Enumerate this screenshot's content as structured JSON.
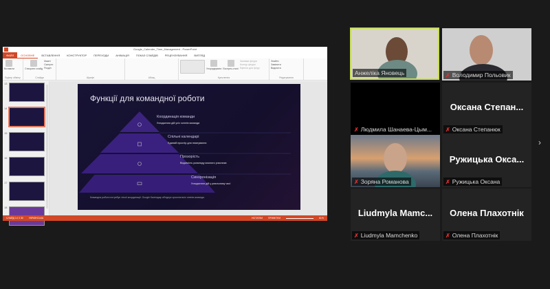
{
  "powerpoint": {
    "window_title": "Google_Calender_Time_Management - PowerPoint",
    "tabs": [
      "ФАЙЛ",
      "ОСНОВНЕ",
      "ВСТАВЛЕННЯ",
      "КОНСТРУКТОР",
      "ПЕРЕХОДИ",
      "АНІМАЦІЯ",
      "ПОКАЗ СЛАЙДІВ",
      "РЕЦЕНЗУВАННЯ",
      "ВИГЛЯД"
    ],
    "ribbon_groups": [
      "Буфер обміну",
      "Слайди",
      "Шрифт",
      "Абзац",
      "Креслення",
      "Редагування"
    ],
    "ribbon_buttons": {
      "paste": "Вставити",
      "new_slide": "Створити слайд",
      "layout": "Макет",
      "reset": "Скинути",
      "section": "Розділ",
      "arrange": "Упорядкувати",
      "quick_styles": "Експрес-стилі",
      "fill": "Заливка фігури",
      "outline": "Контур фігури",
      "effects": "Ефекти для фігур",
      "find": "Знайти",
      "replace": "Замінити",
      "select": "Виділити"
    },
    "thumbnails": [
      "13",
      "14",
      "15",
      "16",
      "17",
      "18"
    ],
    "selected_slide": "14",
    "slide": {
      "title": "Функції для командної роботи",
      "levels": [
        {
          "title": "Координація команди",
          "desc": "Узгодження дій усіх членів команди"
        },
        {
          "title": "Спільні календарі",
          "desc": "Єдиний простір для планування"
        },
        {
          "title": "Прозорість",
          "desc": "Видимість розкладу кожного учасника"
        },
        {
          "title": "Синхронізація",
          "desc": "Узгодження дій у реальному часі"
        }
      ],
      "footer": "Командна робота потребує чіткої координації. Google Календар об'єднує зусилля всіх членів команди."
    },
    "status": {
      "slide": "СЛАЙД 14 З 30",
      "language": "УКРАЇНСЬКА",
      "notes": "НОТАТКИ",
      "comments": "ПРИМІТКИ",
      "zoom": "61%"
    }
  },
  "participants": [
    {
      "name": "Анжеліка Яновець",
      "muted": false,
      "video": true,
      "active": true
    },
    {
      "name": "Володимир Польовик",
      "muted": true,
      "video": true
    },
    {
      "name": "Людмила Шанаева-Цым...",
      "muted": true,
      "video": false
    },
    {
      "name": "Оксана Степанюк",
      "big": "Оксана  Степан...",
      "muted": true,
      "video": false
    },
    {
      "name": "Зоряна Романова",
      "muted": true,
      "video": true
    },
    {
      "name": "Ружицька Оксана",
      "big": "Ружицька  Окса...",
      "muted": true,
      "video": false
    },
    {
      "name": "Liudmyla Mamchenko",
      "big": "Liudmyla  Mamc...",
      "muted": true,
      "video": false
    },
    {
      "name": "Олена Плахотнік",
      "big": "Олена Плахотнік",
      "muted": true,
      "video": false
    }
  ],
  "colors": {
    "accent": "#d24726",
    "active_speaker": "#c7dd5a",
    "muted": "#e0302f",
    "slide_bg": "#171335",
    "pyramid": "#3a1f7a"
  }
}
